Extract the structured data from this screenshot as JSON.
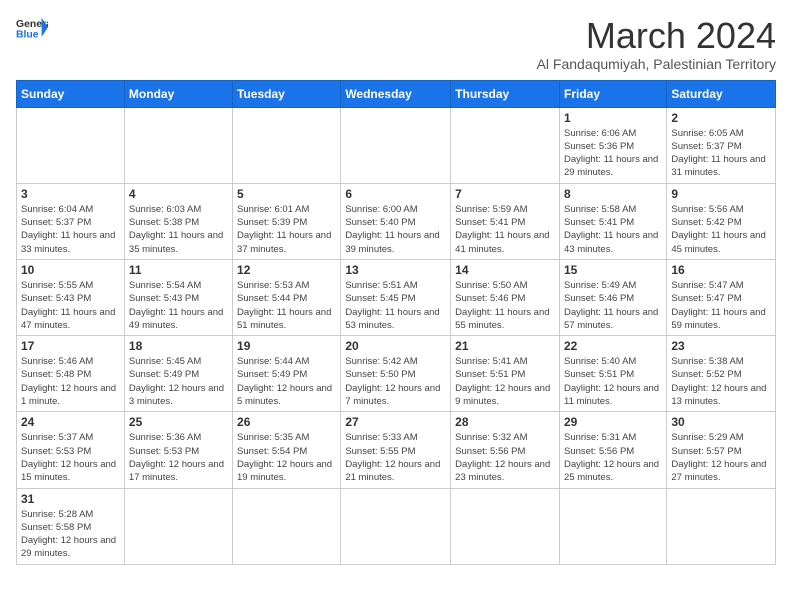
{
  "header": {
    "logo_general": "General",
    "logo_blue": "Blue",
    "month_title": "March 2024",
    "subtitle": "Al Fandaqumiyah, Palestinian Territory"
  },
  "weekdays": [
    "Sunday",
    "Monday",
    "Tuesday",
    "Wednesday",
    "Thursday",
    "Friday",
    "Saturday"
  ],
  "weeks": [
    [
      {
        "day": "",
        "info": ""
      },
      {
        "day": "",
        "info": ""
      },
      {
        "day": "",
        "info": ""
      },
      {
        "day": "",
        "info": ""
      },
      {
        "day": "",
        "info": ""
      },
      {
        "day": "1",
        "info": "Sunrise: 6:06 AM\nSunset: 5:36 PM\nDaylight: 11 hours\nand 29 minutes."
      },
      {
        "day": "2",
        "info": "Sunrise: 6:05 AM\nSunset: 5:37 PM\nDaylight: 11 hours\nand 31 minutes."
      }
    ],
    [
      {
        "day": "3",
        "info": "Sunrise: 6:04 AM\nSunset: 5:37 PM\nDaylight: 11 hours\nand 33 minutes."
      },
      {
        "day": "4",
        "info": "Sunrise: 6:03 AM\nSunset: 5:38 PM\nDaylight: 11 hours\nand 35 minutes."
      },
      {
        "day": "5",
        "info": "Sunrise: 6:01 AM\nSunset: 5:39 PM\nDaylight: 11 hours\nand 37 minutes."
      },
      {
        "day": "6",
        "info": "Sunrise: 6:00 AM\nSunset: 5:40 PM\nDaylight: 11 hours\nand 39 minutes."
      },
      {
        "day": "7",
        "info": "Sunrise: 5:59 AM\nSunset: 5:41 PM\nDaylight: 11 hours\nand 41 minutes."
      },
      {
        "day": "8",
        "info": "Sunrise: 5:58 AM\nSunset: 5:41 PM\nDaylight: 11 hours\nand 43 minutes."
      },
      {
        "day": "9",
        "info": "Sunrise: 5:56 AM\nSunset: 5:42 PM\nDaylight: 11 hours\nand 45 minutes."
      }
    ],
    [
      {
        "day": "10",
        "info": "Sunrise: 5:55 AM\nSunset: 5:43 PM\nDaylight: 11 hours\nand 47 minutes."
      },
      {
        "day": "11",
        "info": "Sunrise: 5:54 AM\nSunset: 5:43 PM\nDaylight: 11 hours\nand 49 minutes."
      },
      {
        "day": "12",
        "info": "Sunrise: 5:53 AM\nSunset: 5:44 PM\nDaylight: 11 hours\nand 51 minutes."
      },
      {
        "day": "13",
        "info": "Sunrise: 5:51 AM\nSunset: 5:45 PM\nDaylight: 11 hours\nand 53 minutes."
      },
      {
        "day": "14",
        "info": "Sunrise: 5:50 AM\nSunset: 5:46 PM\nDaylight: 11 hours\nand 55 minutes."
      },
      {
        "day": "15",
        "info": "Sunrise: 5:49 AM\nSunset: 5:46 PM\nDaylight: 11 hours\nand 57 minutes."
      },
      {
        "day": "16",
        "info": "Sunrise: 5:47 AM\nSunset: 5:47 PM\nDaylight: 11 hours\nand 59 minutes."
      }
    ],
    [
      {
        "day": "17",
        "info": "Sunrise: 5:46 AM\nSunset: 5:48 PM\nDaylight: 12 hours\nand 1 minute."
      },
      {
        "day": "18",
        "info": "Sunrise: 5:45 AM\nSunset: 5:49 PM\nDaylight: 12 hours\nand 3 minutes."
      },
      {
        "day": "19",
        "info": "Sunrise: 5:44 AM\nSunset: 5:49 PM\nDaylight: 12 hours\nand 5 minutes."
      },
      {
        "day": "20",
        "info": "Sunrise: 5:42 AM\nSunset: 5:50 PM\nDaylight: 12 hours\nand 7 minutes."
      },
      {
        "day": "21",
        "info": "Sunrise: 5:41 AM\nSunset: 5:51 PM\nDaylight: 12 hours\nand 9 minutes."
      },
      {
        "day": "22",
        "info": "Sunrise: 5:40 AM\nSunset: 5:51 PM\nDaylight: 12 hours\nand 11 minutes."
      },
      {
        "day": "23",
        "info": "Sunrise: 5:38 AM\nSunset: 5:52 PM\nDaylight: 12 hours\nand 13 minutes."
      }
    ],
    [
      {
        "day": "24",
        "info": "Sunrise: 5:37 AM\nSunset: 5:53 PM\nDaylight: 12 hours\nand 15 minutes."
      },
      {
        "day": "25",
        "info": "Sunrise: 5:36 AM\nSunset: 5:53 PM\nDaylight: 12 hours\nand 17 minutes."
      },
      {
        "day": "26",
        "info": "Sunrise: 5:35 AM\nSunset: 5:54 PM\nDaylight: 12 hours\nand 19 minutes."
      },
      {
        "day": "27",
        "info": "Sunrise: 5:33 AM\nSunset: 5:55 PM\nDaylight: 12 hours\nand 21 minutes."
      },
      {
        "day": "28",
        "info": "Sunrise: 5:32 AM\nSunset: 5:56 PM\nDaylight: 12 hours\nand 23 minutes."
      },
      {
        "day": "29",
        "info": "Sunrise: 5:31 AM\nSunset: 5:56 PM\nDaylight: 12 hours\nand 25 minutes."
      },
      {
        "day": "30",
        "info": "Sunrise: 5:29 AM\nSunset: 5:57 PM\nDaylight: 12 hours\nand 27 minutes."
      }
    ],
    [
      {
        "day": "31",
        "info": "Sunrise: 5:28 AM\nSunset: 5:58 PM\nDaylight: 12 hours\nand 29 minutes."
      },
      {
        "day": "",
        "info": ""
      },
      {
        "day": "",
        "info": ""
      },
      {
        "day": "",
        "info": ""
      },
      {
        "day": "",
        "info": ""
      },
      {
        "day": "",
        "info": ""
      },
      {
        "day": "",
        "info": ""
      }
    ]
  ]
}
